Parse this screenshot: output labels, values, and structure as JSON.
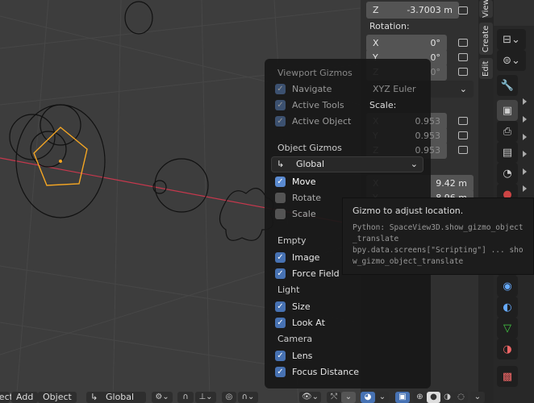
{
  "npanel": {
    "location_z": {
      "axis": "Z",
      "value": "-3.7003 m"
    },
    "rotation_label": "Rotation:",
    "rotation": [
      {
        "axis": "X",
        "value": "0°"
      },
      {
        "axis": "Y",
        "value": "0°"
      },
      {
        "axis": "Z",
        "value": "0°"
      }
    ],
    "rotation_mode": "XYZ Euler",
    "scale_label": "Scale:",
    "scale": [
      {
        "axis": "X",
        "value": "0.953"
      },
      {
        "axis": "Y",
        "value": "0.953"
      },
      {
        "axis": "Z",
        "value": "0.953"
      }
    ],
    "dimensions": [
      {
        "axis": "X",
        "value": "9.42 m"
      },
      {
        "axis": "Y",
        "value": "8.96 m"
      }
    ]
  },
  "tabs": [
    "View",
    "Create",
    "Edit"
  ],
  "popup": {
    "viewport_gizmos": "Viewport Gizmos",
    "navigate": "Navigate",
    "active_tools": "Active Tools",
    "active_object": "Active Object",
    "object_gizmos": "Object Gizmos",
    "orientation": "Global",
    "move": "Move",
    "rotate": "Rotate",
    "scale": "Scale",
    "empty": "Empty",
    "image": "Image",
    "force_field": "Force Field",
    "light": "Light",
    "size": "Size",
    "look_at": "Look At",
    "camera": "Camera",
    "lens": "Lens",
    "focus_distance": "Focus Distance"
  },
  "tooltip": {
    "title": "Gizmo to adjust location.",
    "python1": "Python: SpaceView3D.show_gizmo_object_translate",
    "python2": "bpy.data.screens[\"Scripting\"] ... show_gizmo_object_translate"
  },
  "header": {
    "select": "Select",
    "add": "Add",
    "object": "Object",
    "orientation": "Global"
  },
  "colors": {
    "accent": "#4772b3",
    "selected": "#f5a623",
    "x_axis": "#c6384d"
  }
}
